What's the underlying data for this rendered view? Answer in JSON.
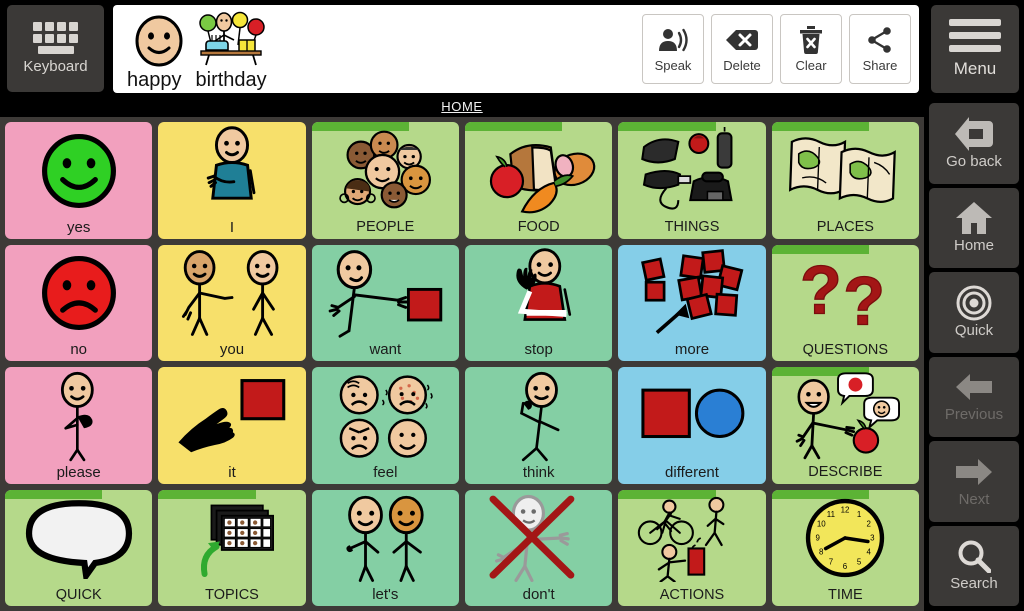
{
  "app": {
    "keyboard_label": "Keyboard",
    "menu_label": "Menu",
    "breadcrumb": "HOME"
  },
  "message_bar": {
    "words": [
      "happy",
      "birthday"
    ],
    "symbols": [
      "happy-face-symbol",
      "birthday-cake-balloons-symbol"
    ],
    "actions": [
      {
        "label": "Speak",
        "icon": "speak-icon"
      },
      {
        "label": "Delete",
        "icon": "backspace-delete-icon"
      },
      {
        "label": "Clear",
        "icon": "trash-clear-icon"
      },
      {
        "label": "Share",
        "icon": "share-icon"
      }
    ]
  },
  "sidebar": {
    "items": [
      {
        "label": "Go back",
        "icon": "go-back-icon",
        "enabled": true
      },
      {
        "label": "Home",
        "icon": "home-icon",
        "enabled": true
      },
      {
        "label": "Quick",
        "icon": "quick-target-icon",
        "enabled": true
      },
      {
        "label": "Previous",
        "icon": "arrow-left-icon",
        "enabled": false
      },
      {
        "label": "Next",
        "icon": "arrow-right-icon",
        "enabled": false
      },
      {
        "label": "Search",
        "icon": "search-icon",
        "enabled": true
      }
    ]
  },
  "colors": {
    "pink": "#f2a0be",
    "yellow": "#f7e06b",
    "mint": "#84cfa4",
    "blue": "#85cee8",
    "category_green": "#b5d98a",
    "folder_tab": "#5cb335",
    "grid_gutter": "#3d3a37",
    "chrome": "#3b3937"
  },
  "grid": {
    "columns": 6,
    "rows": 4,
    "cells": [
      {
        "label": "yes",
        "color": "pink",
        "type": "word",
        "art": "green-smiley-face"
      },
      {
        "label": "I",
        "color": "yellow",
        "type": "word",
        "art": "person-pointing-self"
      },
      {
        "label": "PEOPLE",
        "color": "category_green",
        "type": "category",
        "art": "group-of-faces"
      },
      {
        "label": "FOOD",
        "color": "category_green",
        "type": "category",
        "art": "bread-apple-carrot-ham"
      },
      {
        "label": "THINGS",
        "color": "category_green",
        "type": "category",
        "art": "phone-flashlight-objects"
      },
      {
        "label": "PLACES",
        "color": "category_green",
        "type": "category",
        "art": "maps-scrolls"
      },
      {
        "label": "no",
        "color": "pink",
        "type": "word",
        "art": "red-frowning-face"
      },
      {
        "label": "you",
        "color": "yellow",
        "type": "word",
        "art": "person-pointing-at-other"
      },
      {
        "label": "want",
        "color": "mint",
        "type": "word",
        "art": "person-reaching-for-block"
      },
      {
        "label": "stop",
        "color": "mint",
        "type": "word",
        "art": "person-hand-up-red-shirt"
      },
      {
        "label": "more",
        "color": "blue",
        "type": "word",
        "art": "arrow-to-many-blocks"
      },
      {
        "label": "QUESTIONS",
        "color": "category_green",
        "type": "category",
        "art": "two-question-marks"
      },
      {
        "label": "please",
        "color": "pink",
        "type": "word",
        "art": "person-hand-on-chest"
      },
      {
        "label": "it",
        "color": "yellow",
        "type": "word",
        "art": "hand-pointing-at-block"
      },
      {
        "label": "feel",
        "color": "mint",
        "type": "word",
        "art": "four-emotion-faces"
      },
      {
        "label": "think",
        "color": "mint",
        "type": "word",
        "art": "person-hand-on-chin"
      },
      {
        "label": "different",
        "color": "blue",
        "type": "word",
        "art": "red-square-blue-circle"
      },
      {
        "label": "DESCRIBE",
        "color": "category_green",
        "type": "category",
        "art": "person-describing-apple"
      },
      {
        "label": "QUICK",
        "color": "category_green",
        "type": "category",
        "art": "speech-bubble"
      },
      {
        "label": "TOPICS",
        "color": "category_green",
        "type": "category",
        "art": "stacked-boards-arrow"
      },
      {
        "label": "let's",
        "color": "mint",
        "type": "word",
        "art": "two-people-together"
      },
      {
        "label": "don't",
        "color": "mint",
        "type": "word",
        "art": "crossed-out-person"
      },
      {
        "label": "ACTIONS",
        "color": "category_green",
        "type": "category",
        "art": "cyclist-walker-worker"
      },
      {
        "label": "TIME",
        "color": "category_green",
        "type": "category",
        "art": "clock-face"
      }
    ]
  }
}
